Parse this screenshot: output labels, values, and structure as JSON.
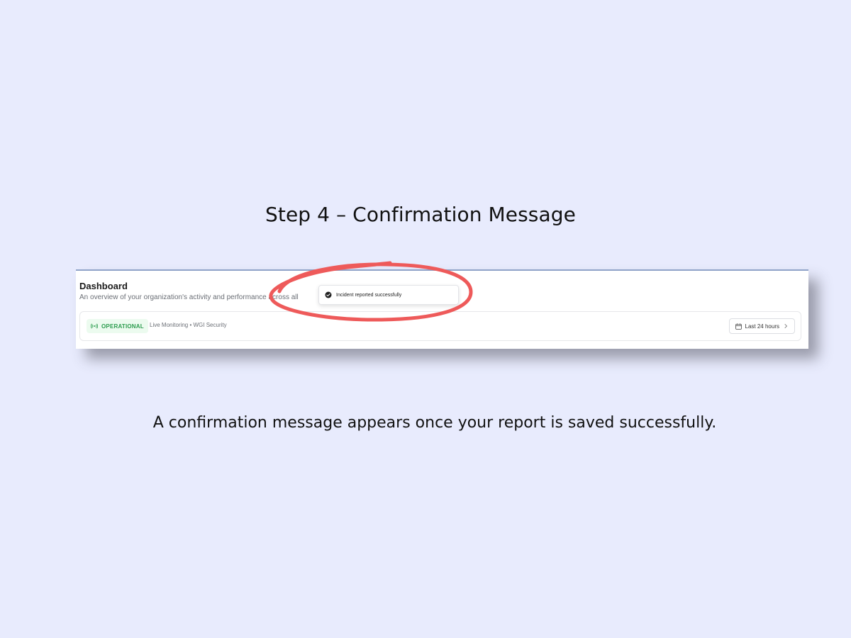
{
  "step_title": "Step 4 – Confirmation Message",
  "caption": "A confirmation message appears once your report is saved successfully.",
  "dashboard": {
    "title": "Dashboard",
    "subtitle": "An overview of your organization's activity and performance across all"
  },
  "toast": {
    "message": "Incident reported successfully",
    "icon": "check-circle-icon"
  },
  "status_bar": {
    "badge_label": "OPERATIONAL",
    "badge_icon": "broadcast-icon",
    "monitor_text": "Live Monitoring • WGI Security",
    "range_label": "Last 24 hours",
    "range_icon": "calendar-icon",
    "range_chevron": "chevron-right-icon"
  },
  "colors": {
    "background": "#e8ebfd",
    "annotation": "#ee5a5a",
    "operational_text": "#2c9c4e",
    "operational_bg": "#ecfbef"
  }
}
